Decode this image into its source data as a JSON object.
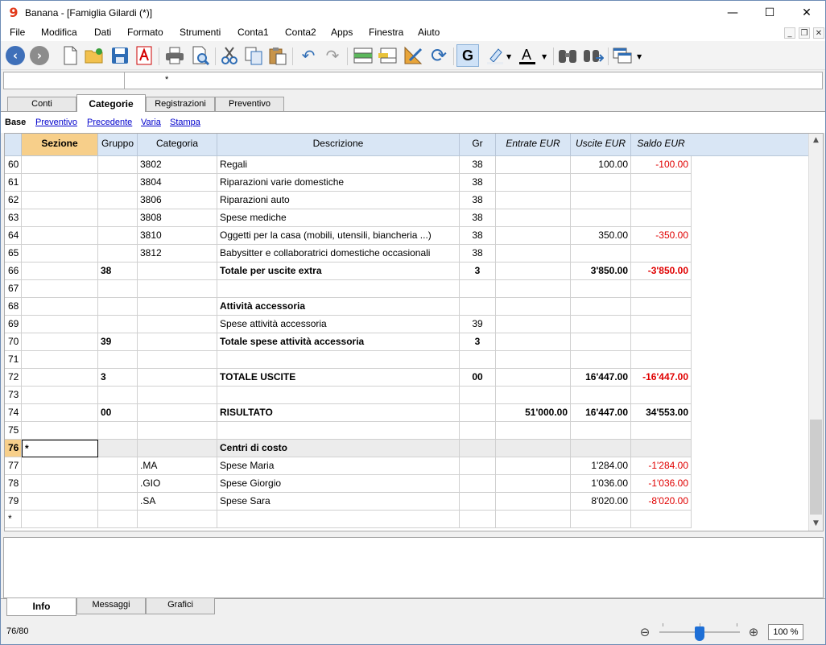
{
  "window": {
    "title": "Banana - [Famiglia Gilardi (*)]",
    "logo_text": "9",
    "minimize": "—",
    "maximize": "☐",
    "close": "✕"
  },
  "menu": [
    "File",
    "Modifica",
    "Dati",
    "Formato",
    "Strumenti",
    "Conta1",
    "Conta2",
    "Apps",
    "Finestra",
    "Aiuto"
  ],
  "formula_bar": {
    "value": "*"
  },
  "tabs": [
    "Conti",
    "Categorie",
    "Registrazioni",
    "Preventivo"
  ],
  "views": [
    "Base",
    "Preventivo",
    "Precedente",
    "Varia",
    "Stampa"
  ],
  "columns": [
    "Sezione",
    "Gruppo",
    "Categoria",
    "Descrizione",
    "Gr",
    "Entrate EUR",
    "Uscite EUR",
    "Saldo EUR"
  ],
  "rows": [
    {
      "n": "60",
      "sezione": "",
      "gruppo": "",
      "categoria": "3802",
      "descrizione": "Regali",
      "gr": "38",
      "entrate": "",
      "uscite": "100.00",
      "saldo": "-100.00",
      "bold": false
    },
    {
      "n": "61",
      "sezione": "",
      "gruppo": "",
      "categoria": "3804",
      "descrizione": "Riparazioni varie domestiche",
      "gr": "38",
      "entrate": "",
      "uscite": "",
      "saldo": "",
      "bold": false
    },
    {
      "n": "62",
      "sezione": "",
      "gruppo": "",
      "categoria": "3806",
      "descrizione": "Riparazioni auto",
      "gr": "38",
      "entrate": "",
      "uscite": "",
      "saldo": "",
      "bold": false
    },
    {
      "n": "63",
      "sezione": "",
      "gruppo": "",
      "categoria": "3808",
      "descrizione": "Spese mediche",
      "gr": "38",
      "entrate": "",
      "uscite": "",
      "saldo": "",
      "bold": false
    },
    {
      "n": "64",
      "sezione": "",
      "gruppo": "",
      "categoria": "3810",
      "descrizione": "Oggetti per la casa (mobili, utensili, biancheria ...)",
      "gr": "38",
      "entrate": "",
      "uscite": "350.00",
      "saldo": "-350.00",
      "bold": false
    },
    {
      "n": "65",
      "sezione": "",
      "gruppo": "",
      "categoria": "3812",
      "descrizione": "Babysitter e collaboratrici domestiche occasionali",
      "gr": "38",
      "entrate": "",
      "uscite": "",
      "saldo": "",
      "bold": false
    },
    {
      "n": "66",
      "sezione": "",
      "gruppo": "38",
      "categoria": "",
      "descrizione": "Totale per uscite extra",
      "gr": "3",
      "entrate": "",
      "uscite": "3'850.00",
      "saldo": "-3'850.00",
      "bold": true
    },
    {
      "n": "67",
      "sezione": "",
      "gruppo": "",
      "categoria": "",
      "descrizione": "",
      "gr": "",
      "entrate": "",
      "uscite": "",
      "saldo": "",
      "bold": false
    },
    {
      "n": "68",
      "sezione": "",
      "gruppo": "",
      "categoria": "",
      "descrizione": "Attività accessoria",
      "gr": "",
      "entrate": "",
      "uscite": "",
      "saldo": "",
      "bold": true
    },
    {
      "n": "69",
      "sezione": "",
      "gruppo": "",
      "categoria": "",
      "descrizione": "Spese attività accessoria",
      "gr": "39",
      "entrate": "",
      "uscite": "",
      "saldo": "",
      "bold": false
    },
    {
      "n": "70",
      "sezione": "",
      "gruppo": "39",
      "categoria": "",
      "descrizione": "Totale spese attività accessoria",
      "gr": "3",
      "entrate": "",
      "uscite": "",
      "saldo": "",
      "bold": true
    },
    {
      "n": "71",
      "sezione": "",
      "gruppo": "",
      "categoria": "",
      "descrizione": "",
      "gr": "",
      "entrate": "",
      "uscite": "",
      "saldo": "",
      "bold": false
    },
    {
      "n": "72",
      "sezione": "",
      "gruppo": "3",
      "categoria": "",
      "descrizione": "TOTALE USCITE",
      "gr": "00",
      "entrate": "",
      "uscite": "16'447.00",
      "saldo": "-16'447.00",
      "bold": true
    },
    {
      "n": "73",
      "sezione": "",
      "gruppo": "",
      "categoria": "",
      "descrizione": "",
      "gr": "",
      "entrate": "",
      "uscite": "",
      "saldo": "",
      "bold": false
    },
    {
      "n": "74",
      "sezione": "",
      "gruppo": "00",
      "categoria": "",
      "descrizione": "RISULTATO",
      "gr": "",
      "entrate": "51'000.00",
      "uscite": "16'447.00",
      "saldo": "34'553.00",
      "bold": true
    },
    {
      "n": "75",
      "sezione": "",
      "gruppo": "",
      "categoria": "",
      "descrizione": "",
      "gr": "",
      "entrate": "",
      "uscite": "",
      "saldo": "",
      "bold": false
    },
    {
      "n": "76",
      "sezione": "*",
      "gruppo": "",
      "categoria": "",
      "descrizione": "Centri di costo",
      "gr": "",
      "entrate": "",
      "uscite": "",
      "saldo": "",
      "bold": true,
      "highlight": true
    },
    {
      "n": "77",
      "sezione": "",
      "gruppo": "",
      "categoria": ".MA",
      "descrizione": "Spese Maria",
      "gr": "",
      "entrate": "",
      "uscite": "1'284.00",
      "saldo": "-1'284.00",
      "bold": false
    },
    {
      "n": "78",
      "sezione": "",
      "gruppo": "",
      "categoria": ".GIO",
      "descrizione": "Spese Giorgio",
      "gr": "",
      "entrate": "",
      "uscite": "1'036.00",
      "saldo": "-1'036.00",
      "bold": false
    },
    {
      "n": "79",
      "sezione": "",
      "gruppo": "",
      "categoria": ".SA",
      "descrizione": "Spese Sara",
      "gr": "",
      "entrate": "",
      "uscite": "8'020.00",
      "saldo": "-8'020.00",
      "bold": false
    },
    {
      "n": "*",
      "sezione": "",
      "gruppo": "",
      "categoria": "",
      "descrizione": "",
      "gr": "",
      "entrate": "",
      "uscite": "",
      "saldo": "",
      "bold": false
    }
  ],
  "bottom_tabs": [
    "Info",
    "Messaggi",
    "Grafici"
  ],
  "status": {
    "row_count": "76/80",
    "zoom": "100 %"
  },
  "colors": {
    "negative": "#e00000",
    "header_bg": "#d9e6f5",
    "selected_header": "#f7cf8a",
    "accent": "#3f70b9"
  }
}
